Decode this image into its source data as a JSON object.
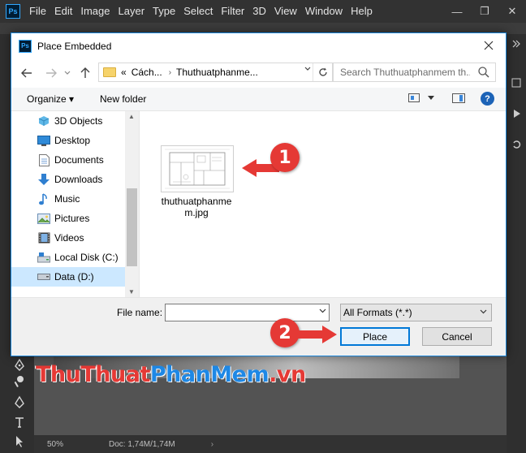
{
  "app": {
    "logo": "Ps",
    "menu": [
      "File",
      "Edit",
      "Image",
      "Layer",
      "Type",
      "Select",
      "Filter",
      "3D",
      "View",
      "Window",
      "Help"
    ],
    "window_controls": [
      "—",
      "❐",
      "✕"
    ]
  },
  "dialog": {
    "title": "Place Embedded",
    "address": {
      "prefix": "«",
      "segments": [
        "Cách...",
        "Thuthuatphanme..."
      ]
    },
    "search": {
      "placeholder": "Search Thuthuatphanmem th..."
    },
    "command_bar": {
      "organize": "Organize ▾",
      "new_folder": "New folder",
      "help": "?"
    },
    "nav_items": [
      {
        "label": "3D Objects",
        "icon": "3d-objects-icon"
      },
      {
        "label": "Desktop",
        "icon": "desktop-icon"
      },
      {
        "label": "Documents",
        "icon": "documents-icon"
      },
      {
        "label": "Downloads",
        "icon": "downloads-icon"
      },
      {
        "label": "Music",
        "icon": "music-icon"
      },
      {
        "label": "Pictures",
        "icon": "pictures-icon"
      },
      {
        "label": "Videos",
        "icon": "videos-icon"
      },
      {
        "label": "Local Disk (C:)",
        "icon": "drive-icon"
      },
      {
        "label": "Data (D:)",
        "icon": "drive-icon",
        "selected": true
      }
    ],
    "files": [
      {
        "name": "thuthuatphanmem.jpg"
      }
    ],
    "file_name_label": "File name:",
    "file_name_value": "",
    "format": "All Formats (*.*)",
    "place_button": "Place",
    "cancel_button": "Cancel"
  },
  "annotations": [
    {
      "label": "1",
      "color": "#e53935"
    },
    {
      "label": "2",
      "color": "#e53935"
    }
  ],
  "watermark": {
    "part_a": "ThuThuat",
    "part_b": "PhanMem",
    "part_c": ".vn"
  },
  "status": {
    "zoom": "50%",
    "doc": "Doc: 1,74M/1,74M",
    "arrow": "›"
  }
}
